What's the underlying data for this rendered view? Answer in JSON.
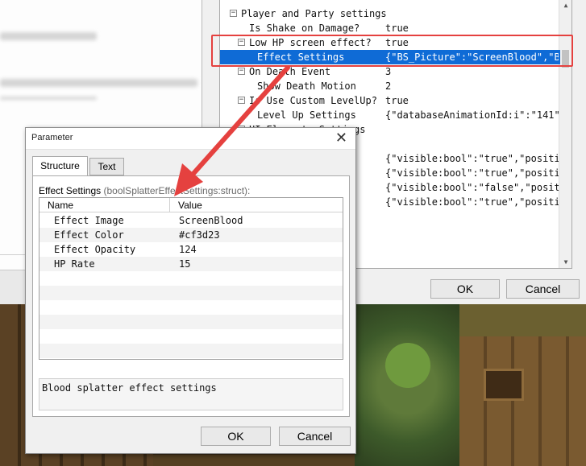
{
  "tree": {
    "rows": [
      {
        "key": "Player and Party settings",
        "value": "",
        "indent": 0,
        "expander": "−"
      },
      {
        "key": "Is Shake on Damage?",
        "value": "true",
        "indent": 1,
        "expander": ""
      },
      {
        "key": "Low HP screen effect?",
        "value": "true",
        "indent": 1,
        "expander": "−"
      },
      {
        "key": "Effect Settings",
        "value": "{\"BS_Picture\":\"ScreenBlood\",\"BS_…",
        "indent": 2,
        "expander": "",
        "selected": true
      },
      {
        "key": "On Death Event",
        "value": "3",
        "indent": 1,
        "expander": "−"
      },
      {
        "key": "Show Death Motion",
        "value": "2",
        "indent": 2,
        "expander": ""
      },
      {
        "key": "Is Use Custom LevelUp?",
        "value": "true",
        "indent": 1,
        "expander": "−"
      },
      {
        "key": "Level Up Settings",
        "value": "{\"databaseAnimationId:i\":\"141\",\"…",
        "indent": 2,
        "expander": ""
      },
      {
        "key": "UI Elements Settings",
        "value": "",
        "indent": 1,
        "expander": "−"
      },
      {
        "key": "",
        "value": "",
        "indent": 2,
        "expander": ""
      },
      {
        "key": "",
        "value": "{\"visible:bool\":\"true\",\"position…",
        "indent": 2,
        "expander": ""
      },
      {
        "key": "",
        "value": "{\"visible:bool\":\"true\",\"position…",
        "indent": 2,
        "expander": ""
      },
      {
        "key": "",
        "value": "{\"visible:bool\":\"false\",\"positio…",
        "indent": 2,
        "expander": ""
      },
      {
        "key": "",
        "value": "{\"visible:bool\":\"true\",\"position…",
        "indent": 2,
        "expander": ""
      }
    ]
  },
  "plugin_buttons": {
    "ok": "OK",
    "cancel": "Cancel"
  },
  "dialog": {
    "title": "Parameter",
    "close_glyph": "✕",
    "tabs": [
      {
        "label": "Structure",
        "active": true
      },
      {
        "label": "Text",
        "active": false
      }
    ],
    "struct_label": "Effect Settings",
    "struct_type": "(boolSplatterEffectSettings:struct):",
    "columns": {
      "name": "Name",
      "value": "Value"
    },
    "rows": [
      {
        "name": "Effect Image",
        "value": "ScreenBlood"
      },
      {
        "name": "Effect Color",
        "value": "#cf3d23"
      },
      {
        "name": "Effect Opacity",
        "value": "124"
      },
      {
        "name": "HP Rate",
        "value": "15"
      }
    ],
    "description": "Blood splatter effect settings",
    "buttons": {
      "ok": "OK",
      "cancel": "Cancel"
    }
  },
  "colors": {
    "annotation": "#e5413f",
    "selection": "#0f6bd6"
  },
  "icons": {
    "close": "close-icon",
    "expander": "tree-collapse-icon"
  }
}
